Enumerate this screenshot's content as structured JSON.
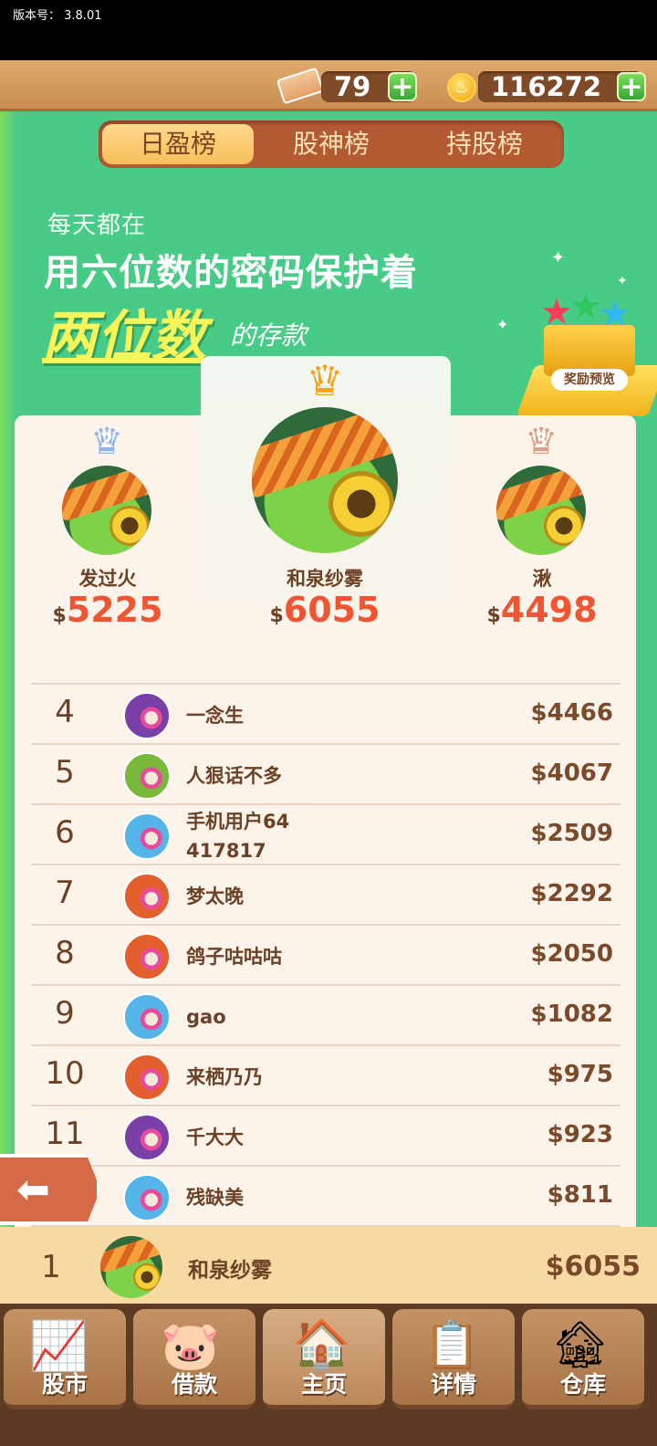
{
  "version_label": "版本号：  3.8.01",
  "resources": {
    "tickets": "79",
    "coins": "116272",
    "plus": "+"
  },
  "tabs": [
    "日盈榜",
    "股神榜",
    "持股榜"
  ],
  "headline": {
    "line1": "每天都在",
    "line2": "用六位数的密码保护着",
    "line3": "两位数",
    "line4": "的存款"
  },
  "reward_label": "奖励预览",
  "podium": [
    {
      "rank": "2",
      "name": "发过火",
      "money": "5225"
    },
    {
      "rank": "1",
      "name": "和泉纱雾",
      "money": "6055"
    },
    {
      "rank": "3",
      "name": "湫",
      "money": "4498"
    }
  ],
  "currency": "$",
  "rows": [
    {
      "rank": "4",
      "name": "一念生",
      "money": "$4466",
      "avatar": "#7b3fa8"
    },
    {
      "rank": "5",
      "name": "人狠话不多",
      "money": "$4067",
      "avatar": "#78b83a"
    },
    {
      "rank": "6",
      "name": "手机用户64",
      "name2": "417817",
      "money": "$2509",
      "avatar": "#55b4e8"
    },
    {
      "rank": "7",
      "name": "梦太晚",
      "money": "$2292",
      "avatar": "#e35f2d"
    },
    {
      "rank": "8",
      "name": "鸽子咕咕咕",
      "money": "$2050",
      "avatar": "#e35f2d"
    },
    {
      "rank": "9",
      "name": "gao",
      "money": "$1082",
      "avatar": "#55b4e8"
    },
    {
      "rank": "10",
      "name": "来栖乃乃",
      "money": "$975",
      "avatar": "#e35f2d"
    },
    {
      "rank": "11",
      "name": "千大大",
      "money": "$923",
      "avatar": "#7b3fa8"
    },
    {
      "rank": "12",
      "name": "残缺美",
      "money": "$811",
      "avatar": "#55b4e8"
    }
  ],
  "me": {
    "rank": "1",
    "name": "和泉纱雾",
    "money": "$6055"
  },
  "nav": [
    "股市",
    "借款",
    "主页",
    "详情",
    "仓库"
  ],
  "colors": {
    "crown_gold": "#f7a21d",
    "crown_silver": "#8fb5ee",
    "crown_bronze": "#d6a184"
  }
}
